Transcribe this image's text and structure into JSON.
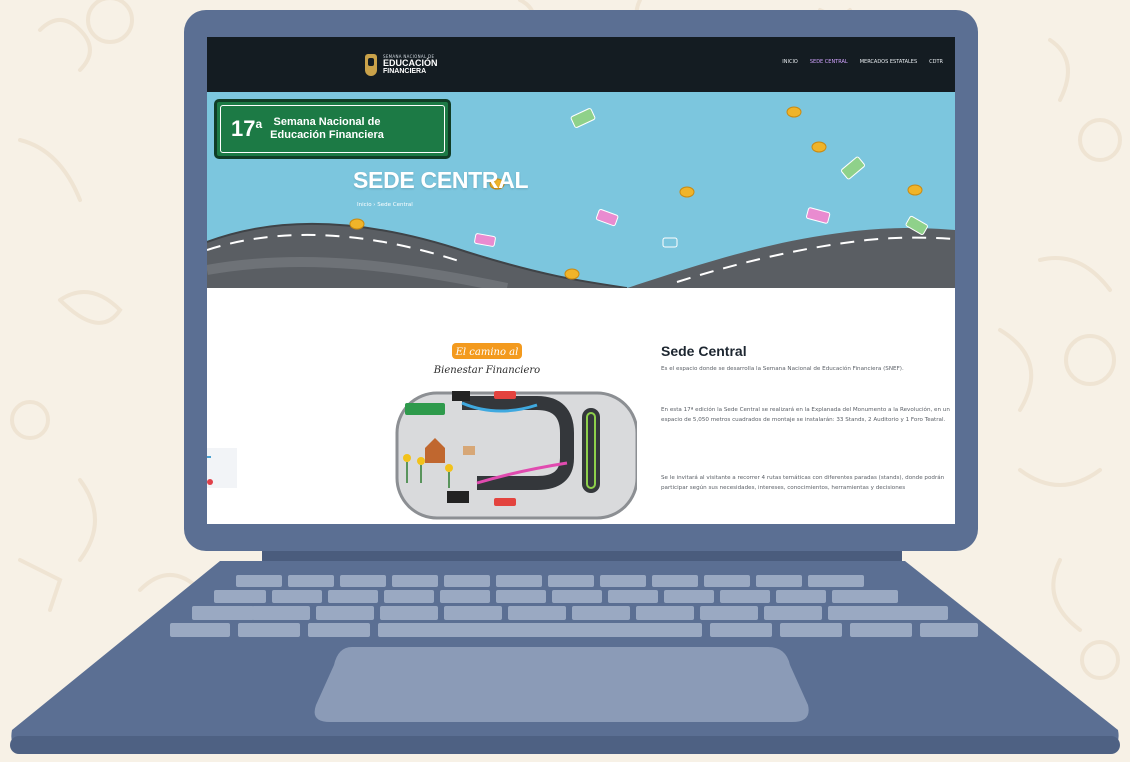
{
  "nav": {
    "logo_small": "SEMANA NACIONAL DE",
    "logo_line1": "EDUCACIÓN",
    "logo_line2": "FINANCIERA",
    "items": [
      {
        "label": "INICIO",
        "active": false
      },
      {
        "label": "SEDE CENTRAL",
        "active": true
      },
      {
        "label": "MERCADOS ESTATALES",
        "active": false
      },
      {
        "label": "CDTR",
        "active": false
      }
    ]
  },
  "hero": {
    "badge_number": "17",
    "badge_sup": "a",
    "badge_line1": "Semana Nacional de",
    "badge_line2": "Educación Financiera",
    "title": "SEDE CENTRAL",
    "breadcrumb": "Inicio  ›  Sede Central"
  },
  "content": {
    "art_title1": "El camino al",
    "art_title2": "Bienestar Financiero",
    "section_title": "Sede Central",
    "paragraph1": "Es el espacio donde se desarrolla la Semana Nacional de Educación Financiera (SNEF).",
    "paragraph2": "En esta 17ª edición la Sede Central se realizará en la Explanada del Monumento a la Revolución, en un espacio de 5,050 metros cuadrados de montaje se instalarán: 33 Stands, 2 Auditorio y 1 Foro Teatral.",
    "paragraph3": "Se le invitará al visitante a recorrer 4 rutas temáticas con diferentes paradas (stands), donde podrán participar según sus necesidades, intereses, conocimientos, herramientas y decisiones"
  },
  "colors": {
    "laptop": "#5b6f93",
    "keys": "#9aa9c2",
    "nav_bg": "#141c22",
    "sky": "#7cc6de",
    "badge": "#1c7a45",
    "active_menu": "#d2a3ff",
    "background": "#f7f1e6"
  }
}
